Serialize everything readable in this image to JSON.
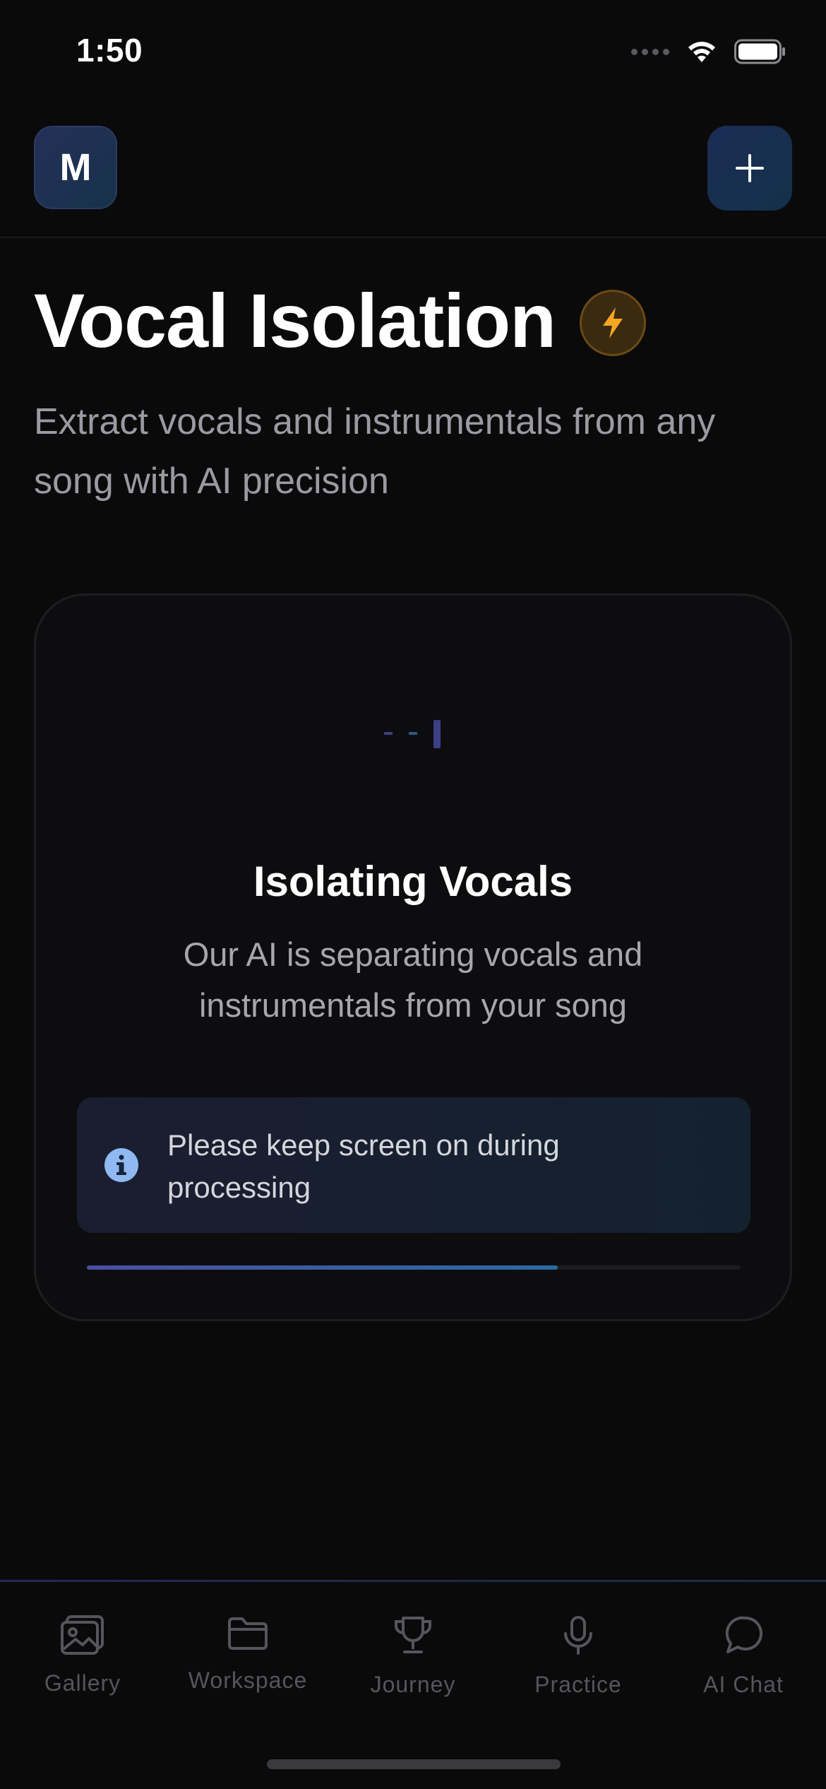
{
  "status_bar": {
    "time": "1:50"
  },
  "header": {
    "avatar_initial": "M",
    "add_icon": "plus-icon"
  },
  "page": {
    "title": "Vocal Isolation",
    "badge_icon": "lightning-bolt-icon",
    "subtitle": "Extract vocals and instrumentals from any song with AI precision"
  },
  "processing_card": {
    "title": "Isolating Vocals",
    "description": "Our AI is separating vocals and instrumentals from your song",
    "notice": {
      "icon": "info-icon",
      "text": "Please keep screen on during processing"
    },
    "progress": 0.72
  },
  "tab_bar": {
    "tabs": [
      {
        "label": "Gallery",
        "icon": "gallery-icon"
      },
      {
        "label": "Workspace",
        "icon": "folder-icon"
      },
      {
        "label": "Journey",
        "icon": "trophy-icon"
      },
      {
        "label": "Practice",
        "icon": "microphone-icon"
      },
      {
        "label": "AI Chat",
        "icon": "chat-bubble-icon"
      }
    ]
  },
  "colors": {
    "background": "#0a0a0b",
    "accent_bolt": "#f5a623",
    "progress_start": "#4a4fa0",
    "progress_end": "#2a6aa0",
    "tab_inactive": "#55565c"
  }
}
